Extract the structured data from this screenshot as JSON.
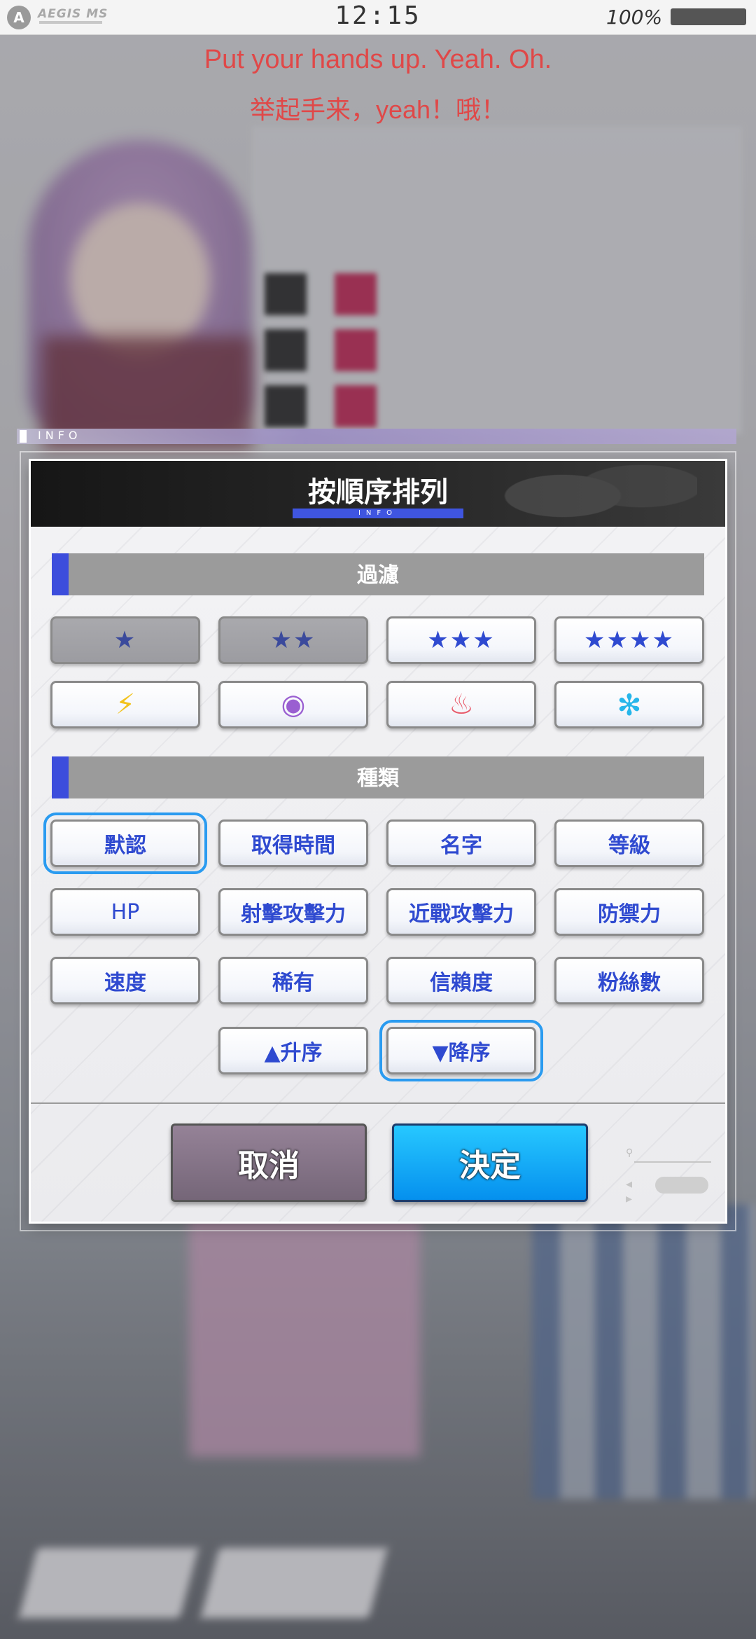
{
  "status_bar": {
    "app_name": "AEGIS MS",
    "logo_letter": "A",
    "time": "12:15",
    "battery": "100%"
  },
  "lyrics": {
    "line_en": "Put your hands up. Yeah. Oh.",
    "line_zh": "举起手来，yeah！哦！"
  },
  "info_label": "INFO",
  "modal": {
    "title": "按順序排列",
    "title_sub": "INFO",
    "filter_section": "過濾",
    "star_filters": [
      {
        "label": "★",
        "active": false
      },
      {
        "label": "★★",
        "active": false
      },
      {
        "label": "★★★",
        "active": true
      },
      {
        "label": "★★★★",
        "active": true
      }
    ],
    "attribute_filters": [
      {
        "icon": "lightning-icon",
        "glyph": "⚡",
        "color": "#f2c21b"
      },
      {
        "icon": "vortex-icon",
        "glyph": "◉",
        "color": "#9a5fd1"
      },
      {
        "icon": "fire-icon",
        "glyph": "♨",
        "color": "#e85a6a"
      },
      {
        "icon": "ice-icon",
        "glyph": "✻",
        "color": "#27b6ea"
      }
    ],
    "type_section": "種類",
    "sort_options": [
      "默認",
      "取得時間",
      "名字",
      "等級",
      "HP",
      "射擊攻擊力",
      "近戰攻擊力",
      "防禦力",
      "速度",
      "稀有",
      "信賴度",
      "粉絲數"
    ],
    "selected_sort": "默認",
    "order_asc": "▲升序",
    "order_desc": "▼降序",
    "selected_order": "desc",
    "cancel_label": "取消",
    "confirm_label": "決定"
  },
  "colors": {
    "accent_blue": "#3c4ddc",
    "button_text": "#2f4ad0",
    "selection_outline": "#2a9bf0",
    "confirm": "#0aa6f6",
    "cancel": "#857488",
    "lyric": "#e04848"
  }
}
